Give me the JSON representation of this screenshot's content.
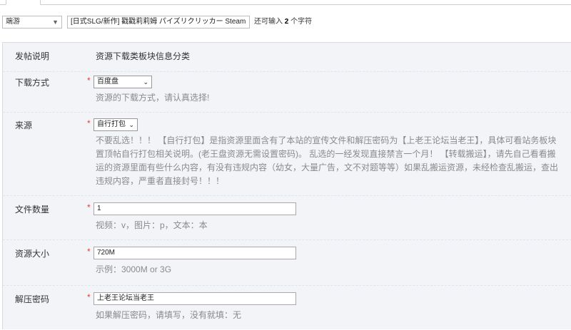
{
  "top": {
    "type_select": "端游",
    "title_value": "[日式SLG/新作] 戳戳莉莉姆 パイズリクリッカー Steam",
    "remain_prefix": "还可输入",
    "remain_count": "2",
    "remain_suffix": "个字符"
  },
  "form": {
    "intro": {
      "label": "发帖说明",
      "value": "资源下载类板块信息分类"
    },
    "download": {
      "label": "下载方式",
      "required": "*",
      "selected": "百度盘",
      "hint": "资源的下载方式，请认真选择!"
    },
    "source": {
      "label": "来源",
      "required": "*",
      "selected": "自行打包",
      "hint_lines": [
        "不要乱选！！！ 【自行打包】是指资源里面含有了本站的宣传文件和解压密码为【上老王论坛当老王】，具体可看站务板块",
        "置顶帖自行打包相关说明。(老王盘资源无需设置密码)。 乱选的一经发现直接禁言一个月！ 【转载搬运】，请先自己看看搬",
        "运的资源里面有些什么内容，有没有违规内容（幼女，大量广告，文不对题等等）如果乱搬运资源，未经检查乱搬运，查出",
        "违规内容，严重者直接封号！！！"
      ]
    },
    "file_count": {
      "label": "文件数量",
      "required": "*",
      "value": "1",
      "hint": "视频：v，图片：p，文本：本"
    },
    "size": {
      "label": "资源大小",
      "required": "*",
      "value": "720M",
      "hint": "示例：3000M or 3G"
    },
    "password": {
      "label": "解压密码",
      "required": "*",
      "value": "上老王论坛当老王",
      "hint": "如果解压密码，请填写，没有就填：无"
    }
  },
  "icons": {
    "dropdown": "chevron-down-icon"
  },
  "colors": {
    "required": "#e23d3d",
    "panel_bg": "#f2f4f8",
    "hint": "#8a8a8a"
  }
}
